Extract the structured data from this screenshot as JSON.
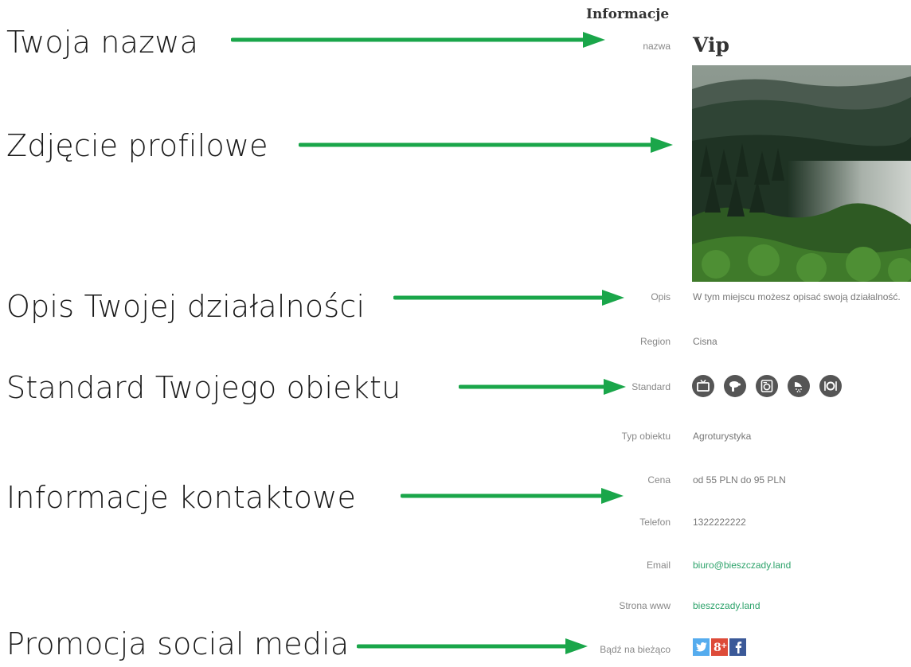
{
  "annotations": [
    {
      "label": "Twoja nazwa"
    },
    {
      "label": "Zdjęcie profilowe"
    },
    {
      "label": "Opis Twojej działalności"
    },
    {
      "label": "Standard Twojego obiektu"
    },
    {
      "label": "Informacje kontaktowe"
    },
    {
      "label": "Promocja social media"
    }
  ],
  "profile": {
    "section_title": "Informacje",
    "name_label": "nazwa",
    "name_value": "Vip",
    "description_label": "Opis",
    "description_value": "W tym miejscu możesz opisać swoją działalność.",
    "region_label": "Region",
    "region_value": "Cisna",
    "standard_label": "Standard",
    "amenities": [
      "tv-icon",
      "hair-dryer-icon",
      "washing-machine-icon",
      "shower-icon",
      "restaurant-icon"
    ],
    "type_label": "Typ obiektu",
    "type_value": "Agroturystyka",
    "price_label": "Cena",
    "price_value": "od 55 PLN do 95 PLN",
    "phone_label": "Telefon",
    "phone_value": "1322222222",
    "email_label": "Email",
    "email_value": "biuro@bieszczady.land",
    "website_label": "Strona www",
    "website_value": "bieszczady.land",
    "social_label": "Bądź na bieżąco",
    "social": [
      "twitter-icon",
      "google-plus-icon",
      "facebook-icon"
    ]
  },
  "colors": {
    "arrow": "#1aa64a",
    "link": "#2ea36b",
    "twitter": "#55acee",
    "google_plus": "#dd4b39",
    "facebook": "#3b5998",
    "amenity": "#555555"
  }
}
